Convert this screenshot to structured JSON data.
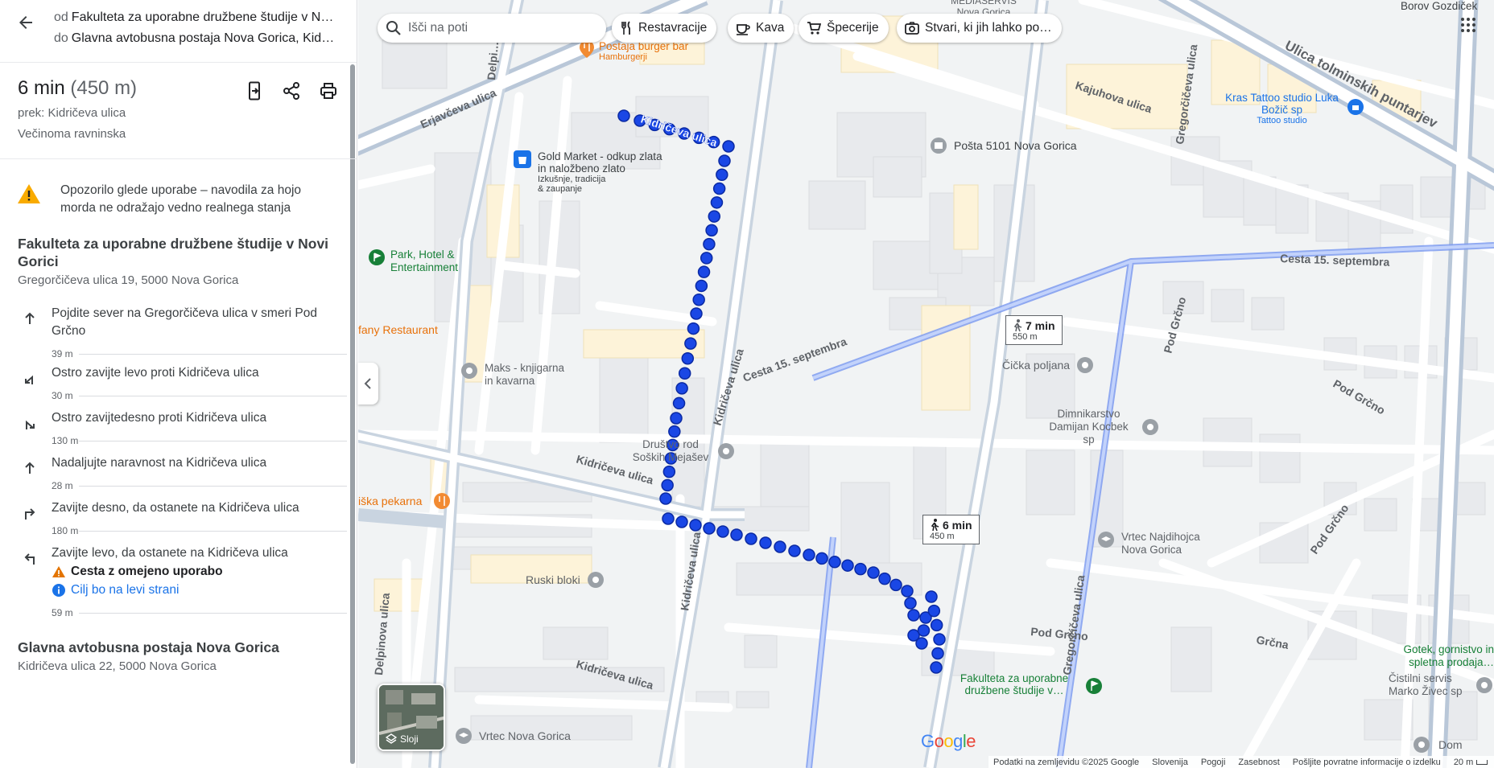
{
  "route": {
    "from_prefix": "od",
    "from": "Fakulteta za uporabne družbene študije v Novi Gorici",
    "to_prefix": "do",
    "to": "Glavna avtobusna postaja Nova Gorica, Kidričeva ulica 22, 5000 Nova Gorica"
  },
  "summary": {
    "time": "6 min",
    "distance": "(450 m)",
    "via": "prek: Kidričeva ulica",
    "terrain": "Večinoma ravninska"
  },
  "warning": "Opozorilo glede uporabe – navodila za hojo morda ne odražajo vedno realnega stanja",
  "origin": {
    "name": "Fakulteta za uporabne družbene študije v Novi Gorici",
    "address": "Gregorčičeva ulica 19, 5000 Nova Gorica"
  },
  "steps": [
    {
      "icon": "straight-arrow-icon",
      "text": "Pojdite sever na Gregorčičeva ulica v smeri Pod Grčno",
      "distance": "39 m"
    },
    {
      "icon": "sharp-left-arrow-icon",
      "text": "Ostro zavijte levo proti Kidričeva ulica",
      "distance": "30 m"
    },
    {
      "icon": "sharp-right-arrow-icon",
      "text": "Ostro zavijtedesno proti Kidričeva ulica",
      "distance": "130 m"
    },
    {
      "icon": "straight-arrow-icon",
      "text": "Nadaljujte naravnost na Kidričeva ulica",
      "distance": "28 m"
    },
    {
      "icon": "turn-right-arrow-icon",
      "text": "Zavijte desno, da ostanete na Kidričeva ulica",
      "distance": "180 m"
    },
    {
      "icon": "turn-left-arrow-icon",
      "text": "Zavijte levo, da ostanete na Kidričeva ulica",
      "distance": "59 m",
      "warning_note": "Cesta z omejeno uporabo",
      "info_note": "Cilj bo na levi strani"
    }
  ],
  "destination": {
    "name": "Glavna avtobusna postaja Nova Gorica",
    "address": "Kidričeva ulica 22, 5000 Nova Gorica"
  },
  "search": {
    "placeholder": "Išči na poti"
  },
  "chips": [
    {
      "label": "Restavracije",
      "icon": "fork-knife-icon"
    },
    {
      "label": "Kava",
      "icon": "coffee-cup-icon"
    },
    {
      "label": "Špecerije",
      "icon": "shopping-cart-icon"
    },
    {
      "label": "Stvari, ki jih lahko po…",
      "icon": "camera-icon"
    }
  ],
  "map": {
    "route_tip_main": {
      "time": "6 min",
      "distance": "450 m"
    },
    "route_tip_alt": {
      "time": "7 min",
      "distance": "550 m"
    },
    "streets": [
      "Erjavčeva ulica",
      "Kidričeva ulica",
      "Kidričeva ulica",
      "Kidričeva ulica",
      "Kidričeva ulica",
      "Kidričeva ulica",
      "Kajuhova ulica",
      "Gregorčičeva ulica",
      "Gregorčičeva ulica",
      "Cesta 15. septembra",
      "Cesta 15. septembra",
      "Ulica tolminskih puntarjev",
      "Pod Grčno",
      "Pod Grčno",
      "Pod Grčno",
      "Pod Grčno",
      "Grčna",
      "Delpinova ulica",
      "Delpi…"
    ],
    "places": [
      {
        "name": "Postaja burger bar",
        "sub": "Hamburgerji"
      },
      {
        "name": "Gold Market - odkup zlata in naložbeno zlato",
        "sub": "Izkušnje, tradicija & zaupanje"
      },
      {
        "name": "Pošta 5101 Nova Gorica"
      },
      {
        "name": "Kras Tattoo studio Luka Božič sp",
        "sub": "Tattoo studio"
      },
      {
        "name": "Park, Hotel & Entertainment"
      },
      {
        "name": "Maks - knjigarna in kavarna"
      },
      {
        "name": "Čička poljana"
      },
      {
        "name": "Dimnikarstvo Damijan Kocbek sp"
      },
      {
        "name": "Društvo rod Soških Mejašev"
      },
      {
        "name": "Ruski bloki"
      },
      {
        "name": "Vrtec Najdihojca Nova Gorica"
      },
      {
        "name": "Fakulteta za uporabne družbene študije v…"
      },
      {
        "name": "Vrtec Nova Gorica"
      },
      {
        "name": "Čistilni servis Marko Živec sp"
      },
      {
        "name": "Gotek, gornistvo in spletna prodaja…"
      },
      {
        "name": "Dom"
      },
      {
        "name": "Borov Gozdiček"
      },
      {
        "name": "MEDIASERVIS Nova Gorica"
      },
      {
        "name": "fany Restaurant"
      },
      {
        "name": "iška pekarna"
      }
    ],
    "layers_label": "Sloji",
    "logo": "Google"
  },
  "footer": {
    "items": [
      "Podatki na zemljevidu ©2025 Google",
      "Slovenija",
      "Pogoji",
      "Zasebnost",
      "Pošljite povratne informacije o izdelku",
      "20 m"
    ]
  },
  "colors": {
    "route": "#1a47e5",
    "route_alt": "#9fb4f4",
    "accent": "#1a73e8",
    "warning": "#f9ab00",
    "poi_food": "#f28b32",
    "poi_green": "#188038"
  }
}
